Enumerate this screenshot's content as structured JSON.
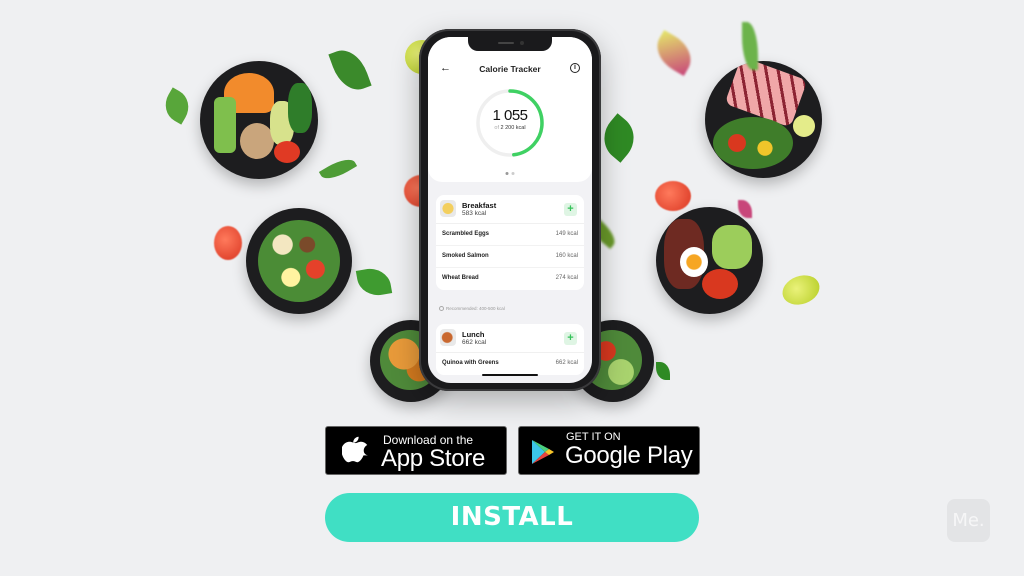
{
  "app": {
    "screen_title": "Calorie Tracker",
    "calories": {
      "consumed": "1 055",
      "of_label": "of",
      "goal": "2 200 kcal",
      "progress_fraction": 0.48,
      "page_dots": 2,
      "active_dot": 0
    },
    "meals": [
      {
        "name": "Breakfast",
        "kcal": "583 kcal",
        "items": [
          {
            "name": "Scrambled Eggs",
            "kcal": "149 kcal"
          },
          {
            "name": "Smoked Salmon",
            "kcal": "160 kcal"
          },
          {
            "name": "Wheat Bread",
            "kcal": "274 kcal"
          }
        ],
        "recommendation": "Recommended: 400-500 kcal"
      },
      {
        "name": "Lunch",
        "kcal": "662 kcal",
        "items": [
          {
            "name": "Quinoa with Greens",
            "kcal": "662 kcal"
          }
        ]
      }
    ],
    "add_symbol": "+",
    "back_symbol": "←",
    "info_symbol": "i"
  },
  "store_buttons": {
    "apple": {
      "line1": "Download on the",
      "line2": "App Store"
    },
    "google": {
      "line1": "GET IT ON",
      "line2": "Google Play"
    }
  },
  "cta": {
    "label": "INSTALL",
    "color": "#40dfc4"
  },
  "watermark": {
    "label": "Me."
  },
  "colors": {
    "background": "#eff0f2",
    "ring_progress": "#3fd163",
    "ring_track": "#efefef",
    "add_button_bg": "#dff5e4",
    "add_button_fg": "#36c25a"
  }
}
